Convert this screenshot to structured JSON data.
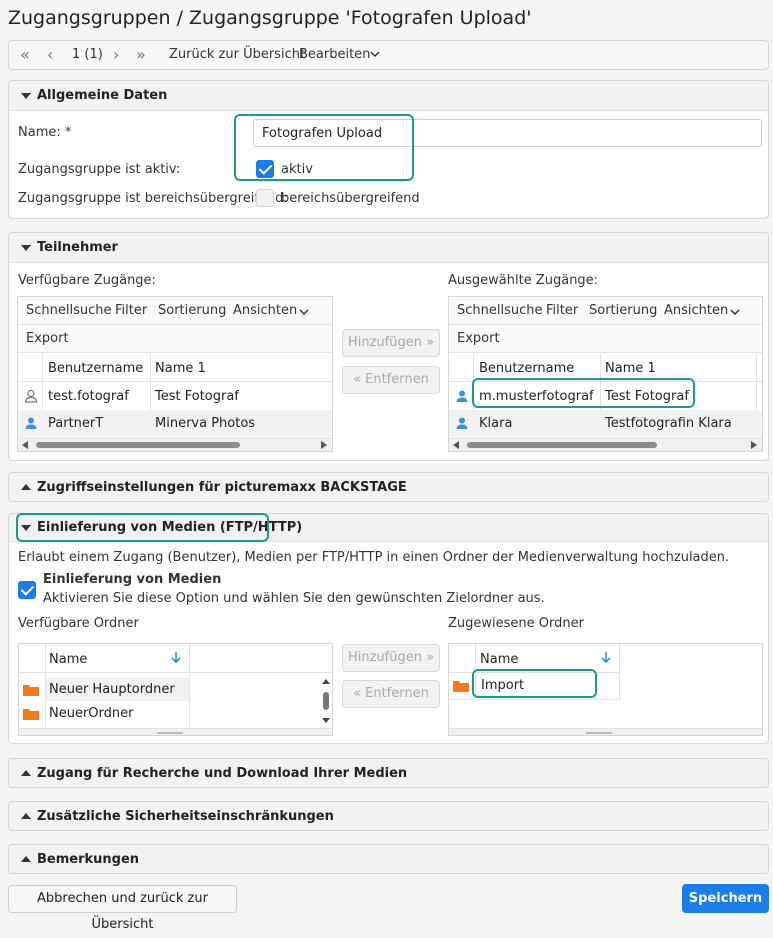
{
  "page": {
    "title": "Zugangsgruppen / Zugangsgruppe 'Fotografen Upload'"
  },
  "toolbar": {
    "page_indicator": "1 (1)",
    "back_label": "Zurück zur Übersicht",
    "edit_label": "Bearbeiten"
  },
  "general": {
    "title": "Allgemeine Daten",
    "name_label": "Name:",
    "required_mark": "*",
    "name_value": "Fotografen Upload",
    "active_label": "Zugangsgruppe ist aktiv:",
    "active_checkbox_label": "aktiv",
    "active_checked": true,
    "cross_area_label": "Zugangsgruppe ist bereichsübergreifend:",
    "cross_area_checkbox_label": "bereichsübergreifend",
    "cross_area_checked": false
  },
  "participants": {
    "title": "Teilnehmer",
    "available_label": "Verfügbare Zugänge:",
    "selected_label": "Ausgewählte Zugänge:",
    "grid_toolbar": {
      "quicksearch": "Schnellsuche",
      "filter": "Filter",
      "sort": "Sortierung",
      "views": "Ansichten",
      "export": "Export"
    },
    "columns": [
      "Benutzername",
      "Name 1"
    ],
    "available_rows": [
      {
        "username": "test.fotograf",
        "name": "Test Fotograf",
        "icon": "user-outline-icon"
      },
      {
        "username": "PartnerT",
        "name": "Minerva Photos",
        "icon": "user-blue-icon"
      }
    ],
    "selected_rows": [
      {
        "username": "m.musterfotograf",
        "name": "Test Fotograf",
        "icon": "user-blue-icon"
      },
      {
        "username": "Klara",
        "name": "Testfotografin Klara",
        "icon": "user-blue-icon"
      }
    ],
    "add_button": "Hinzufügen »",
    "remove_button": "« Entfernen"
  },
  "access_settings": {
    "title": "Zugriffseinstellungen für picturemaxx BACKSTAGE"
  },
  "media_delivery": {
    "title": "Einlieferung von Medien (FTP/HTTP)",
    "description": "Erlaubt einem Zugang (Benutzer), Medien per FTP/HTTP in einen Ordner der Medienverwaltung hochzuladen.",
    "option_label": "Einlieferung von Medien",
    "option_hint": "Aktivieren Sie diese Option und wählen Sie den gewünschten Zielordner aus.",
    "option_checked": true,
    "available_label": "Verfügbare Ordner",
    "assigned_label": "Zugewiesene Ordner",
    "column_name": "Name",
    "available_folders": [
      "Neuer Hauptordner",
      "NeuerOrdner"
    ],
    "assigned_folders": [
      "Import"
    ],
    "add_button": "Hinzufügen »",
    "remove_button": "« Entfernen"
  },
  "collapsed_sections": {
    "research": "Zugang für Recherche und Download Ihrer Medien",
    "security": "Zusätzliche Sicherheitseinschränkungen",
    "remarks": "Bemerkungen"
  },
  "footer": {
    "cancel_label": "Abbrechen und zurück zur Übersicht",
    "save_label": "Speichern"
  },
  "colors": {
    "accent": "#1b7ee8",
    "highlight": "#1a9c86",
    "folder": "#f07a1c"
  }
}
